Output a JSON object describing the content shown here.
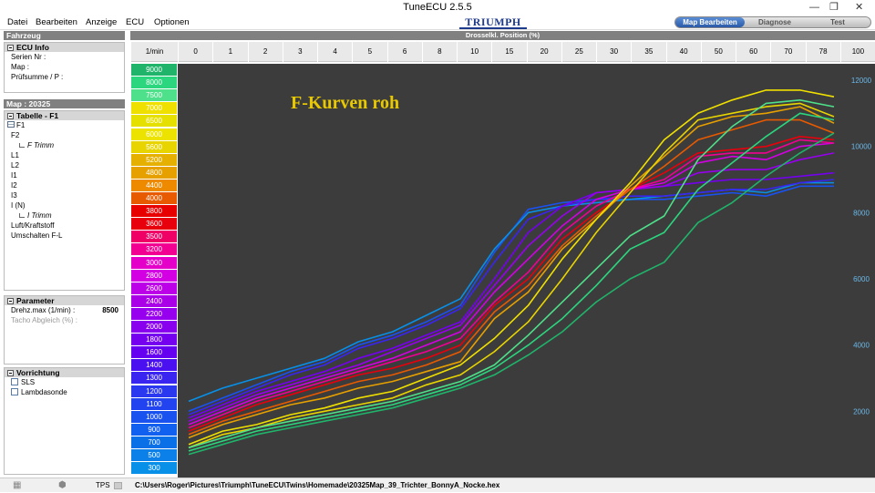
{
  "window": {
    "title": "TuneECU 2.5.5",
    "min": "—",
    "restore": "❐",
    "close": "✕"
  },
  "menu": [
    "Datei",
    "Bearbeiten",
    "Anzeige",
    "ECU",
    "Optionen"
  ],
  "logo": "TRIUMPH",
  "tabs": {
    "map": "Map Bearbeiten",
    "diag": "Diagnose",
    "test": "Test"
  },
  "left": {
    "fahrzeug": "Fahrzeug",
    "ecu_info": {
      "header": "ECU Info",
      "serial": "Serien Nr :",
      "map": "Map :",
      "checksum": "Prüfsumme / P :"
    },
    "map_header": "Map : 20325",
    "tabelle": {
      "header": "Tabelle - F1",
      "items": [
        "F1",
        "F2",
        "F Trimm",
        "L1",
        "L2",
        "I1",
        "I2",
        "I3",
        "I (N)",
        "I Trimm",
        "Luft/Kraftstoff",
        "Umschalten F-L"
      ]
    },
    "parameter": {
      "header": "Parameter",
      "drehz_label": "Drehz.max (1/min) :",
      "drehz_value": "8500",
      "tacho_label": "Tacho Abgleich (%) :"
    },
    "vorrichtung": {
      "header": "Vorrichtung",
      "sls": "SLS",
      "lambda": "Lambdasonde"
    }
  },
  "main": {
    "header": "Drosselkl. Position (%)",
    "rpm_label": "1/min",
    "columns": [
      "0",
      "1",
      "2",
      "3",
      "4",
      "5",
      "6",
      "8",
      "10",
      "15",
      "20",
      "25",
      "30",
      "35",
      "40",
      "50",
      "60",
      "70",
      "78",
      "100"
    ],
    "rpm_rows": [
      "9000",
      "8000",
      "7500",
      "7000",
      "6500",
      "6000",
      "5600",
      "5200",
      "4800",
      "4400",
      "4000",
      "3800",
      "3600",
      "3500",
      "3200",
      "3000",
      "2800",
      "2600",
      "2400",
      "2200",
      "2000",
      "1800",
      "1600",
      "1400",
      "1300",
      "1200",
      "1100",
      "1000",
      "900",
      "700",
      "500",
      "300"
    ],
    "rpm_colors": [
      "#1fb46a",
      "#2bd67e",
      "#4ee08a",
      "#f0e000",
      "#e6e000",
      "#ece400",
      "#e8d400",
      "#e6b000",
      "#e6a000",
      "#ee8a00",
      "#e85a00",
      "#e80000",
      "#e8000c",
      "#ef0066",
      "#f10092",
      "#e400c8",
      "#d300e4",
      "#bc00e8",
      "#aa00e8",
      "#9700ee",
      "#8800ee",
      "#7500f0",
      "#6600f0",
      "#4a10f0",
      "#3a24f0",
      "#2a38f0",
      "#2244f0",
      "#1a52f0",
      "#1260f0",
      "#0a70e8",
      "#0a80e8",
      "#0890e8"
    ],
    "plot_title": "F-Kurven roh"
  },
  "chart_data": {
    "type": "line",
    "title": "F-Kurven roh",
    "x": [
      "0",
      "1",
      "2",
      "3",
      "4",
      "5",
      "6",
      "8",
      "10",
      "15",
      "20",
      "25",
      "30",
      "35",
      "40",
      "50",
      "60",
      "70",
      "78",
      "100"
    ],
    "ylim": [
      0,
      12000
    ],
    "yticks": [
      "2000",
      "4000",
      "6000",
      "8000",
      "10000",
      "12000"
    ],
    "series": [
      {
        "color": "#1a52f0",
        "values": [
          2000,
          2400,
          2800,
          3200,
          3500,
          4000,
          4300,
          4700,
          5200,
          6800,
          8100,
          8300,
          8400,
          8400,
          8400,
          8500,
          8600,
          8500,
          8800,
          8800
        ]
      },
      {
        "color": "#0890e8",
        "values": [
          2300,
          2700,
          3000,
          3300,
          3600,
          4100,
          4400,
          4900,
          5400,
          6900,
          8000,
          8200,
          8300,
          8400,
          8500,
          8600,
          8700,
          8600,
          8900,
          8900
        ]
      },
      {
        "color": "#3a24f0",
        "values": [
          1900,
          2300,
          2700,
          3100,
          3400,
          3900,
          4200,
          4600,
          5100,
          6500,
          7800,
          8200,
          8400,
          8500,
          8500,
          8600,
          8700,
          8700,
          8900,
          9000
        ]
      },
      {
        "color": "#7500f0",
        "values": [
          1800,
          2200,
          2600,
          2900,
          3200,
          3600,
          3900,
          4300,
          4700,
          6000,
          7400,
          8200,
          8600,
          8700,
          8800,
          8900,
          9000,
          9000,
          9100,
          9200
        ]
      },
      {
        "color": "#9700ee",
        "values": [
          1700,
          2100,
          2500,
          2800,
          3100,
          3400,
          3800,
          4200,
          4600,
          5800,
          7000,
          7900,
          8600,
          8700,
          8800,
          9200,
          9300,
          9300,
          9600,
          9800
        ]
      },
      {
        "color": "#d300e4",
        "values": [
          1600,
          2000,
          2400,
          2700,
          3000,
          3300,
          3600,
          4000,
          4400,
          5600,
          6600,
          7600,
          8400,
          8700,
          8900,
          9500,
          9700,
          9600,
          10000,
          10100
        ]
      },
      {
        "color": "#f10092",
        "values": [
          1500,
          1900,
          2300,
          2600,
          2900,
          3200,
          3500,
          3800,
          4200,
          5300,
          6200,
          7400,
          8200,
          8700,
          9000,
          9700,
          9800,
          9800,
          10200,
          10100
        ]
      },
      {
        "color": "#e8000c",
        "values": [
          1400,
          1800,
          2200,
          2500,
          2800,
          3100,
          3300,
          3600,
          4000,
          5200,
          6000,
          7200,
          8000,
          8700,
          9200,
          9800,
          9900,
          10000,
          10300,
          10200
        ]
      },
      {
        "color": "#e85a00",
        "values": [
          1300,
          1700,
          2000,
          2300,
          2600,
          2900,
          3100,
          3400,
          3800,
          5000,
          5800,
          7000,
          7900,
          8700,
          9400,
          10200,
          10500,
          10800,
          10800,
          10400
        ]
      },
      {
        "color": "#e6a000",
        "values": [
          1200,
          1600,
          1900,
          2200,
          2400,
          2700,
          2900,
          3200,
          3500,
          4800,
          5600,
          6900,
          7800,
          8800,
          9700,
          10600,
          10900,
          11000,
          11200,
          10700
        ]
      },
      {
        "color": "#f0e000",
        "values": [
          1000,
          1400,
          1600,
          1900,
          2100,
          2400,
          2600,
          3000,
          3400,
          4200,
          5200,
          6600,
          7800,
          8900,
          10200,
          11000,
          11400,
          11700,
          11700,
          11500
        ]
      },
      {
        "color": "#e8d400",
        "values": [
          900,
          1300,
          1500,
          1800,
          2000,
          2200,
          2400,
          2800,
          3100,
          3800,
          4700,
          6000,
          7400,
          8600,
          9800,
          10800,
          11000,
          11200,
          11300,
          10900
        ]
      },
      {
        "color": "#4ee08a",
        "values": [
          900,
          1200,
          1500,
          1700,
          1900,
          2100,
          2300,
          2600,
          2900,
          3400,
          4300,
          5300,
          6300,
          7300,
          7900,
          9600,
          10600,
          11300,
          11400,
          11200
        ]
      },
      {
        "color": "#2bd67e",
        "values": [
          800,
          1100,
          1400,
          1600,
          1800,
          2000,
          2200,
          2500,
          2800,
          3300,
          4000,
          4800,
          5800,
          6900,
          7400,
          8700,
          9500,
          10300,
          11000,
          10800
        ]
      },
      {
        "color": "#1fb46a",
        "values": [
          700,
          1000,
          1300,
          1500,
          1700,
          1900,
          2100,
          2400,
          2700,
          3100,
          3700,
          4400,
          5300,
          6000,
          6500,
          7700,
          8300,
          9100,
          9800,
          10400
        ]
      }
    ]
  },
  "status": {
    "tps": "TPS",
    "path": "C:\\Users\\Roger\\Pictures\\Triumph\\TuneECU\\Twins\\Homemade\\20325Map_39_Trichter_BonnyA_Nocke.hex"
  }
}
